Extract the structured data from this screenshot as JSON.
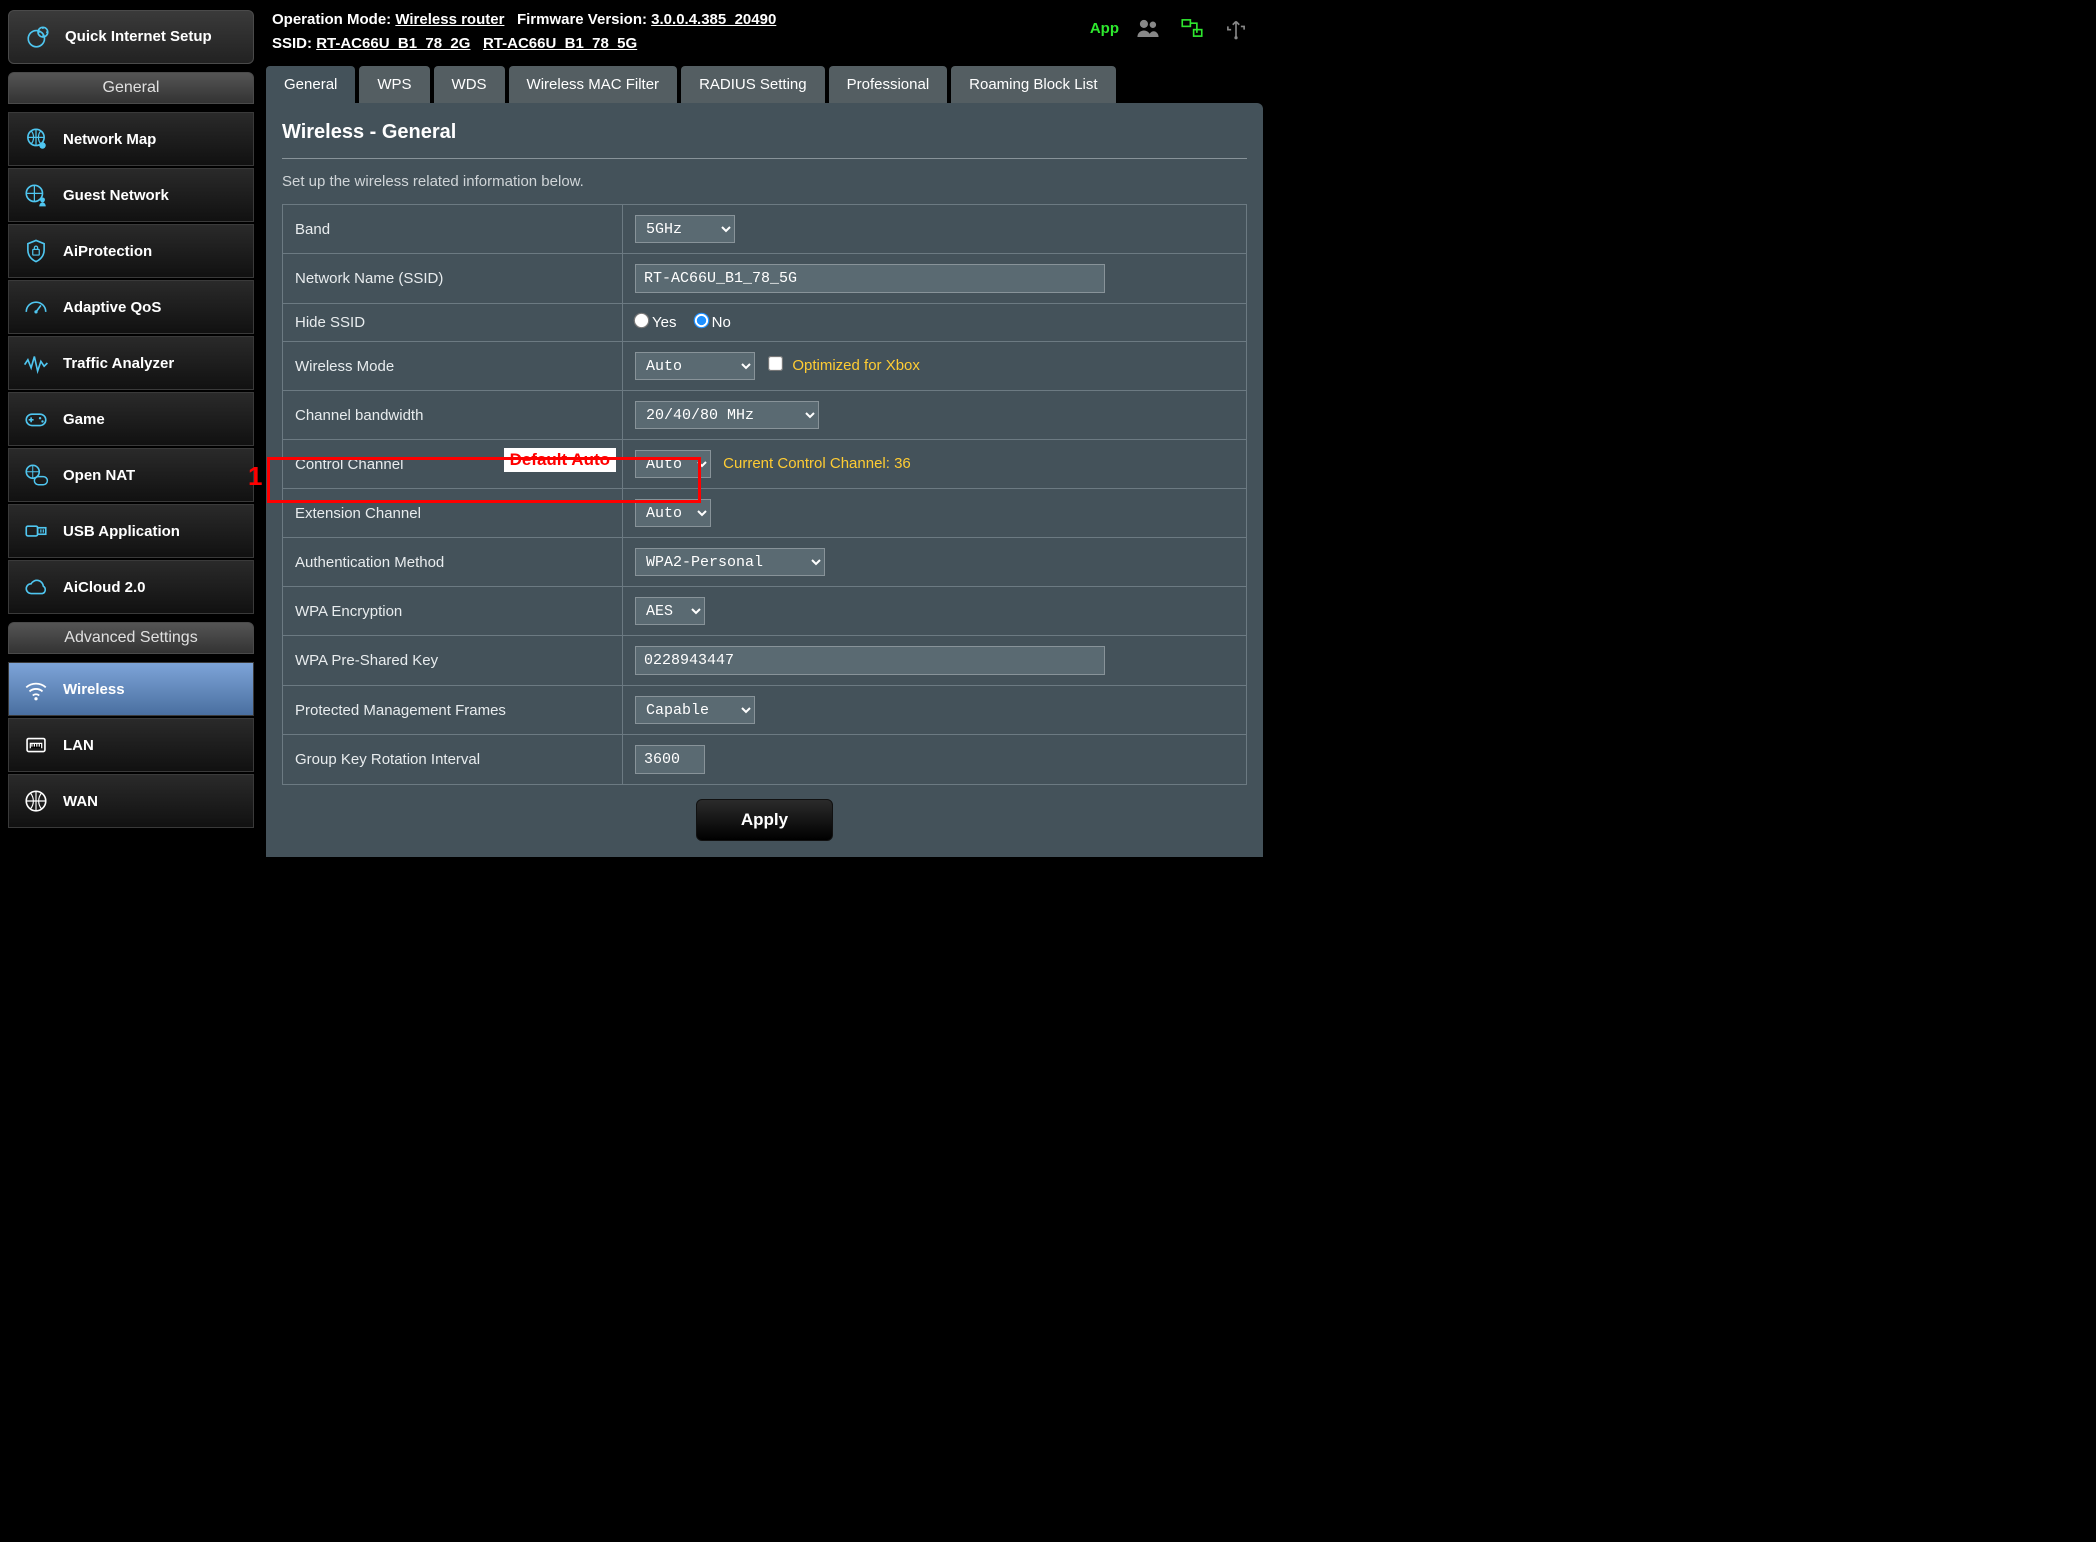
{
  "top": {
    "op_mode_label": "Operation Mode:",
    "op_mode_value": "Wireless router",
    "fw_label": "Firmware Version:",
    "fw_value": "3.0.0.4.385_20490",
    "ssid_label": "SSID:",
    "ssid_2g": "RT-AC66U_B1_78_2G",
    "ssid_5g": "RT-AC66U_B1_78_5G",
    "app_label": "App"
  },
  "sidebar": {
    "qis": "Quick Internet Setup",
    "general_header": "General",
    "general_items": [
      "Network Map",
      "Guest Network",
      "AiProtection",
      "Adaptive QoS",
      "Traffic Analyzer",
      "Game",
      "Open NAT",
      "USB Application",
      "AiCloud 2.0"
    ],
    "adv_header": "Advanced Settings",
    "adv_items": [
      "Wireless",
      "LAN",
      "WAN"
    ]
  },
  "tabs": [
    "General",
    "WPS",
    "WDS",
    "Wireless MAC Filter",
    "RADIUS Setting",
    "Professional",
    "Roaming Block List"
  ],
  "panel": {
    "title": "Wireless - General",
    "desc": "Set up the wireless related information below."
  },
  "form": {
    "band_label": "Band",
    "band_value": "5GHz",
    "ssid_label": "Network Name (SSID)",
    "ssid_value": "RT-AC66U_B1_78_5G",
    "hide_label": "Hide SSID",
    "hide_yes": "Yes",
    "hide_no": "No",
    "wmode_label": "Wireless Mode",
    "wmode_value": "Auto",
    "wmode_xbox": "Optimized for Xbox",
    "bw_label": "Channel bandwidth",
    "bw_value": "20/40/80 MHz",
    "ctrl_label": "Control Channel",
    "ctrl_value": "Auto",
    "ctrl_hint": "Current Control Channel: 36",
    "ctrl_badge": "Default Auto",
    "ext_label": "Extension Channel",
    "ext_value": "Auto",
    "auth_label": "Authentication Method",
    "auth_value": "WPA2-Personal",
    "enc_label": "WPA Encryption",
    "enc_value": "AES",
    "psk_label": "WPA Pre-Shared Key",
    "psk_value": "0228943447",
    "pmf_label": "Protected Management Frames",
    "pmf_value": "Capable",
    "gk_label": "Group Key Rotation Interval",
    "gk_value": "3600",
    "apply": "Apply",
    "annotation_num": "1"
  }
}
